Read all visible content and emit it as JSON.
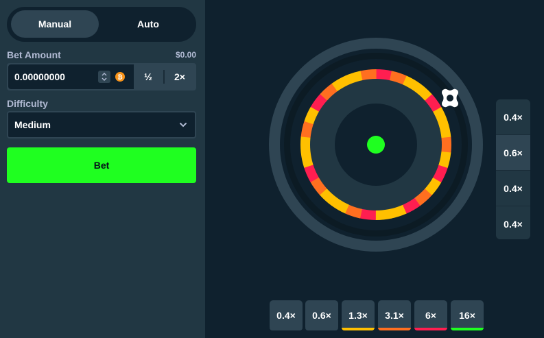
{
  "mode_tabs": {
    "manual": "Manual",
    "auto": "Auto"
  },
  "bet_amount": {
    "label": "Bet Amount",
    "usd_value": "$0.00",
    "value": "0.00000000",
    "half_label": "½",
    "double_label": "2×",
    "currency_icon": "bitcoin-icon"
  },
  "difficulty": {
    "label": "Difficulty",
    "selected": "Medium"
  },
  "bet_button_label": "Bet",
  "wheel": {
    "segment_colors": {
      "yellow": "#ffc000",
      "orange": "#ff6f20",
      "red": "#ff1e50",
      "center": "#1fff20"
    },
    "pointer_icon": "wheel-pointer-icon"
  },
  "side_multipliers": [
    {
      "label": "0.4×",
      "highlighted": false
    },
    {
      "label": "0.6×",
      "highlighted": true
    },
    {
      "label": "0.4×",
      "highlighted": false
    },
    {
      "label": "0.4×",
      "highlighted": false
    }
  ],
  "bottom_multipliers": [
    {
      "label": "0.4×",
      "color": "#2f4553"
    },
    {
      "label": "0.6×",
      "color": "#2f4553"
    },
    {
      "label": "1.3×",
      "color": "#ffc000"
    },
    {
      "label": "3.1×",
      "color": "#ff6f20"
    },
    {
      "label": "6×",
      "color": "#ff1e50"
    },
    {
      "label": "16×",
      "color": "#1fff20"
    }
  ]
}
